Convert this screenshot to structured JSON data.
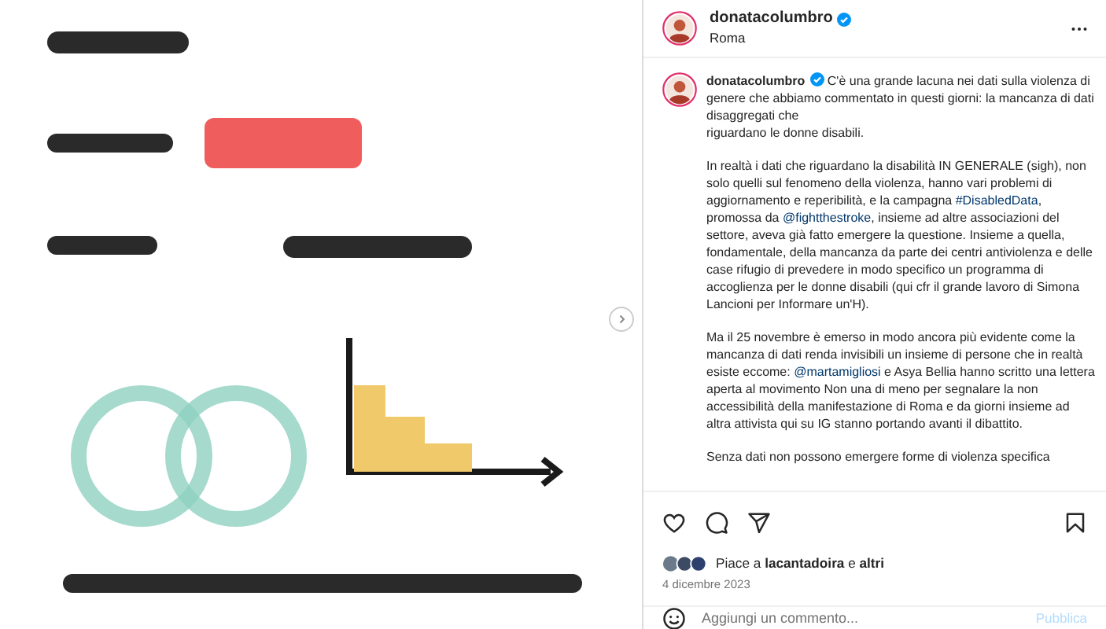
{
  "header": {
    "username": "donatacolumbro",
    "verified": true,
    "location": "Roma"
  },
  "caption": {
    "username": "donatacolumbro",
    "verified": true,
    "paragraphs": [
      [
        {
          "kind": "text",
          "text": "C'è una grande lacuna nei dati sulla violenza di genere che abbiamo commentato in questi giorni: la mancanza di dati disaggregati che"
        },
        {
          "kind": "br"
        },
        {
          "kind": "text",
          "text": "riguardano le donne disabili."
        }
      ],
      [
        {
          "kind": "text",
          "text": "In realtà i dati che riguardano la disabilità IN GENERALE (sigh), non solo quelli sul fenomeno della violenza, hanno vari problemi di aggiornamento e reperibilità, e la campagna "
        },
        {
          "kind": "link",
          "text": "#DisabledData"
        },
        {
          "kind": "text",
          "text": ", promossa da "
        },
        {
          "kind": "link",
          "text": "@fightthestroke"
        },
        {
          "kind": "text",
          "text": ", insieme ad altre associazioni del settore, aveva già fatto emergere la questione. Insieme a quella, fondamentale, della mancanza da parte dei centri antiviolenza e delle case rifugio di prevedere in modo specifico un programma di accoglienza per le donne disabili (qui cfr il grande lavoro di Simona Lancioni per Informare un'H)."
        }
      ],
      [
        {
          "kind": "text",
          "text": "Ma il 25 novembre è emerso in modo ancora più evidente come la mancanza di dati renda invisibili un insieme di persone che in realtà esiste eccome: "
        },
        {
          "kind": "link",
          "text": "@martamigliosi"
        },
        {
          "kind": "text",
          "text": " e Asya Bellia hanno scritto una lettera aperta al movimento Non una di meno per segnalare la non accessibilità della manifestazione di Roma e da giorni insieme ad altra attivista qui su IG stanno portando avanti il dibattito."
        }
      ],
      [
        {
          "kind": "text",
          "text": "Senza dati non possono emergere forme di violenza specifica"
        }
      ]
    ]
  },
  "actions": {
    "liked": false,
    "saved": false
  },
  "likes": {
    "prefix": "Piace a",
    "user": "lacantadoira",
    "joiner": "e",
    "others": "altri"
  },
  "date": "4 dicembre 2023",
  "comment": {
    "placeholder": "Aggiungi un commento...",
    "button": "Pubblica"
  }
}
